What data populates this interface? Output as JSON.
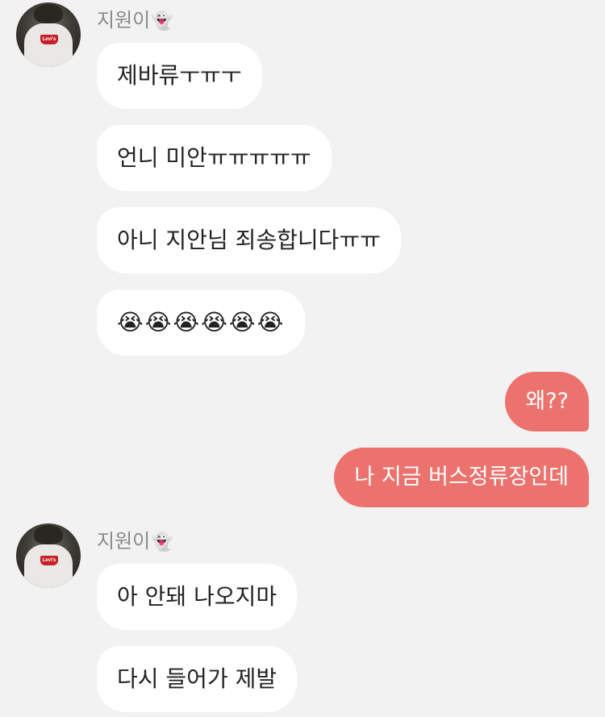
{
  "messages": {
    "group1": {
      "sender": "지원이",
      "sender_emoji": "👻",
      "bubbles": [
        "제바류ㅜㅠㅜ",
        "언니 미안ㅠㅠㅠㅠㅠ",
        "아니 지안님 죄송합니다ㅠㅠ",
        "😭😭😭😭😭😭"
      ]
    },
    "mine": [
      "왜??",
      "나 지금 버스정류장인데"
    ],
    "group2": {
      "sender": "지원이",
      "sender_emoji": "👻",
      "bubbles": [
        "아 안돼 나오지마",
        "다시 들어가 제발"
      ]
    }
  },
  "colors": {
    "background": "#f2f2f2",
    "incoming_bubble": "#ffffff",
    "outgoing_bubble": "#ec726d",
    "sender_name": "#8a8a8a"
  }
}
